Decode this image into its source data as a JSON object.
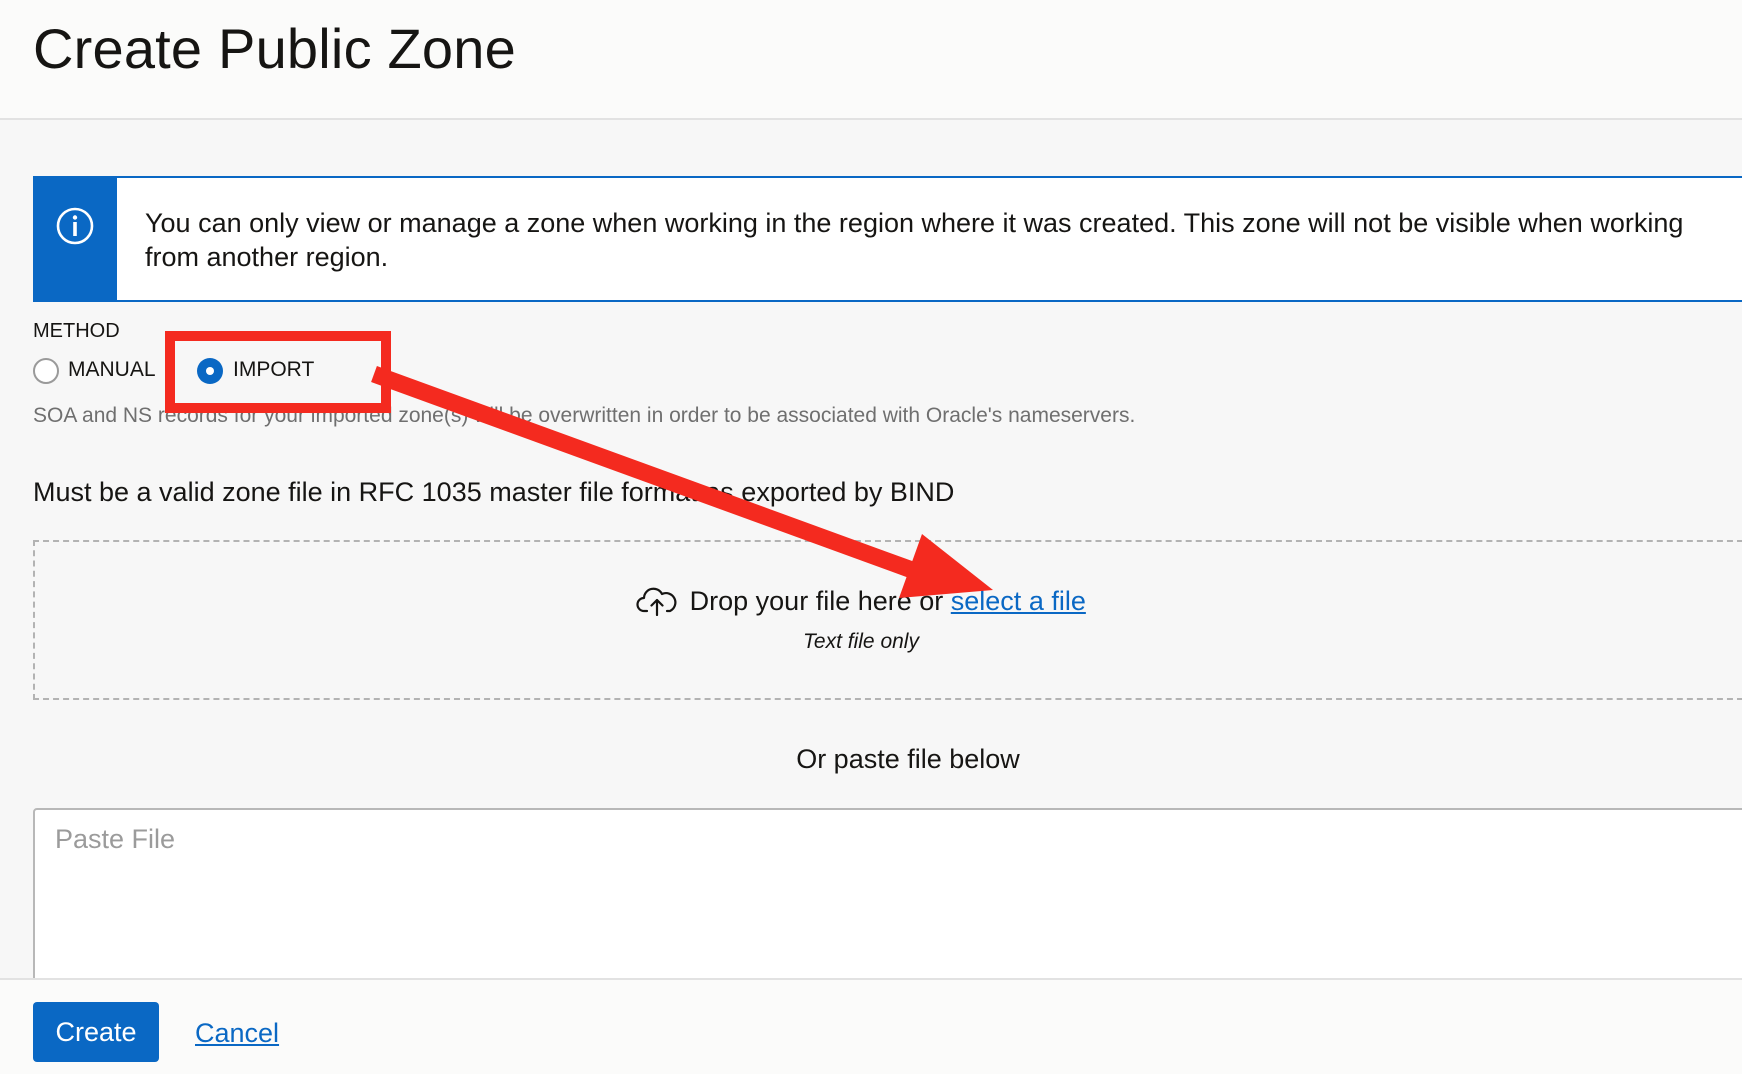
{
  "page": {
    "title": "Create Public Zone"
  },
  "banner": {
    "icon": "info-icon",
    "message": "You can only view or manage a zone when working in the region where it was created. This zone will not be visible when working from another region."
  },
  "method": {
    "label": "METHOD",
    "options": [
      {
        "label": "MANUAL",
        "selected": false
      },
      {
        "label": "IMPORT",
        "selected": true
      }
    ],
    "hint": "SOA and NS records for your imported zone(s) will be overwritten in order to be associated with Oracle's nameservers."
  },
  "import": {
    "requirement": "Must be a valid zone file in RFC 1035 master file format as exported by BIND",
    "dropzone": {
      "icon": "cloud-upload-icon",
      "text": "Drop your file here or",
      "link": "select a file",
      "subtext": "Text file only"
    },
    "paste_heading": "Or paste file below",
    "paste_placeholder": "Paste File"
  },
  "footer": {
    "create_label": "Create",
    "cancel_label": "Cancel"
  },
  "annotation": {
    "highlight_color": "#f42a1f"
  },
  "colors": {
    "accent": "#0a68c4",
    "annotation": "#f42a1f"
  }
}
